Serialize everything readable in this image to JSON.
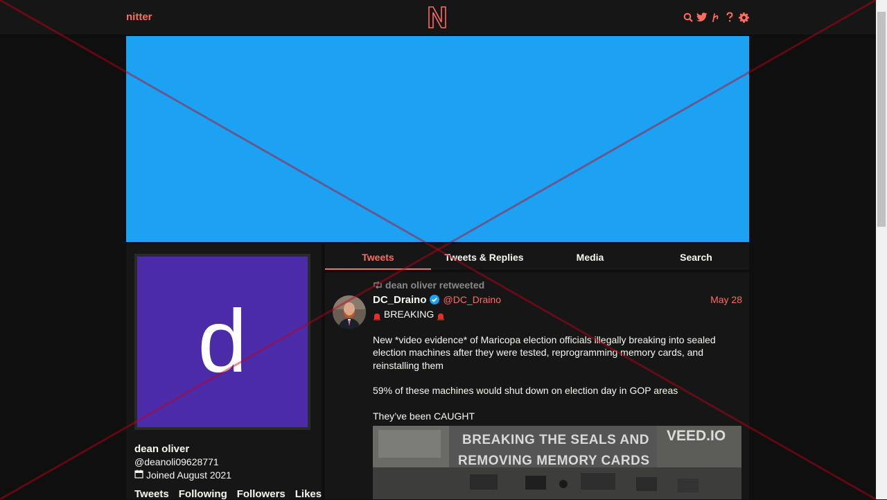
{
  "nav": {
    "brand": "nitter",
    "logo_letter": "N",
    "icons": [
      "search-icon",
      "twitter-bird-icon",
      "rss-icon",
      "help-icon",
      "settings-gear-icon"
    ]
  },
  "profile": {
    "avatar_letter": "d",
    "fullname": "dean oliver",
    "username": "@deanoli09628771",
    "joindate": "Joined August 2021",
    "stats": [
      "Tweets",
      "Following",
      "Followers",
      "Likes"
    ]
  },
  "tabs": [
    "Tweets",
    "Tweets & Replies",
    "Media",
    "Search"
  ],
  "tweet": {
    "retweet_label": "dean oliver retweeted",
    "author_name": "DC_Draino",
    "author_handle": "@DC_Draino",
    "date": "May 28",
    "line1": "BREAKING",
    "para1": "New *video evidence* of Maricopa election officials illegally breaking into sealed election machines after they were tested, reprogramming memory cards, and reinstalling them",
    "para2": "59% of these machines would shut down on election day in GOP areas",
    "para3": "They’ve been CAUGHT",
    "media_caption_1": "BREAKING THE SEALS AND",
    "media_caption_2": "REMOVING MEMORY CARDS",
    "media_watermark": "VEED.IO"
  },
  "colors": {
    "accent": "#ff6c60",
    "banner": "#1da1f2",
    "avatar_bg": "#4b2ba7",
    "overlay_red": "#c0001a",
    "overlay_blue": "#3b6fd1"
  }
}
